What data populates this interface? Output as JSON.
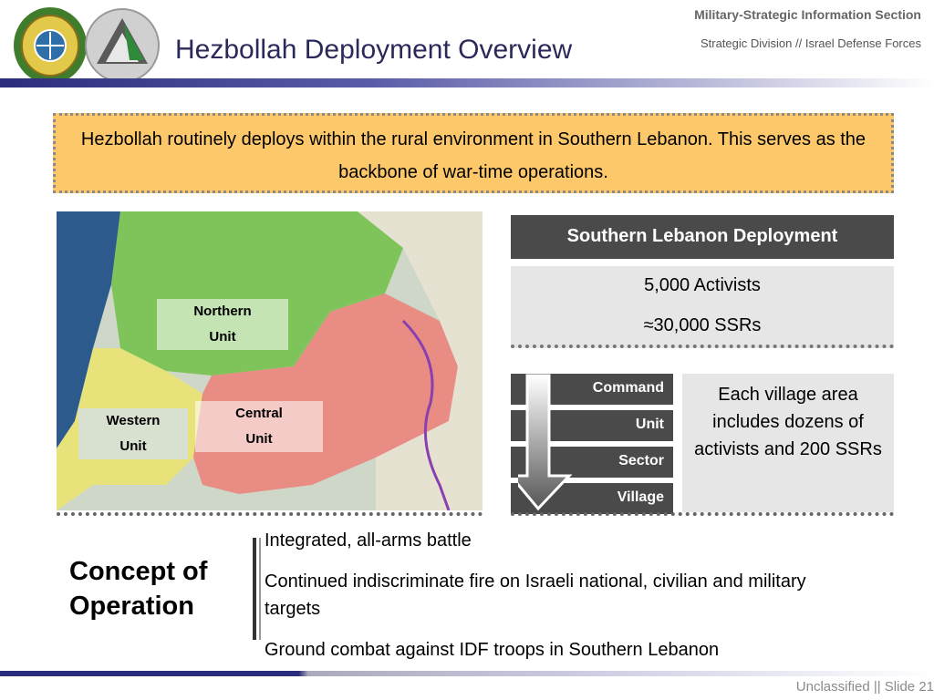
{
  "header": {
    "title": "Hezbollah Deployment Overview",
    "section": "Military-Strategic Information Section",
    "division": "Strategic Division // Israel Defense Forces"
  },
  "intro": {
    "text": "Hezbollah routinely deploys within the rural environment in Southern Lebanon. This serves as the backbone of war-time operations."
  },
  "map": {
    "labels": {
      "northern": [
        "Northern",
        "Unit"
      ],
      "western": [
        "Western",
        "Unit"
      ],
      "central": [
        "Central",
        "Unit"
      ]
    },
    "colors": {
      "northern": "#7fc45a",
      "western": "#e8e27a",
      "central": "#e88c84",
      "background": "#cfd8c8",
      "sea": "#2c5a8c"
    }
  },
  "deployment": {
    "heading": "Southern Lebanon Deployment",
    "activists": "5,000 Activists",
    "ssrs": "≈30,000 SSRs"
  },
  "hierarchy": {
    "levels": [
      "Command",
      "Unit",
      "Sector",
      "Village"
    ],
    "note": "Each village area includes dozens of activists and 200 SSRs"
  },
  "concept": {
    "title_line1": "Concept of",
    "title_line2": "Operation",
    "bullets": [
      "Integrated, all-arms battle",
      "Continued indiscriminate fire on Israeli national, civilian and military targets",
      "Ground combat against IDF troops in Southern Lebanon"
    ]
  },
  "footer": {
    "text": "Unclassified || Slide 21"
  }
}
